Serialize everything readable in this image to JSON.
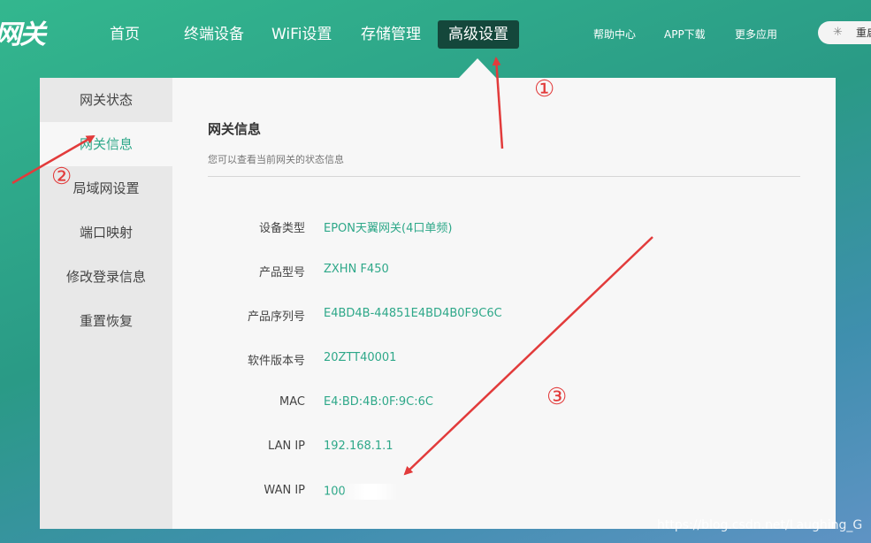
{
  "logo": {
    "text": "网关"
  },
  "nav": {
    "items": [
      {
        "label": "首页"
      },
      {
        "label": "终端设备"
      },
      {
        "label": "WiFi设置"
      },
      {
        "label": "存储管理"
      },
      {
        "label": "高级设置",
        "active": true
      }
    ]
  },
  "utility": {
    "help": "帮助中心",
    "app": "APP下载",
    "more": "更多应用",
    "restart": "重启"
  },
  "sidebar": {
    "items": [
      {
        "label": "网关状态"
      },
      {
        "label": "网关信息",
        "active": true
      },
      {
        "label": "局域网设置"
      },
      {
        "label": "端口映射"
      },
      {
        "label": "修改登录信息"
      },
      {
        "label": "重置恢复"
      }
    ]
  },
  "content": {
    "title": "网关信息",
    "subtitle": "您可以查看当前网关的状态信息",
    "rows": [
      {
        "label": "设备类型",
        "value": "EPON天翼网关(4口单频)"
      },
      {
        "label": "产品型号",
        "value": "ZXHN F450"
      },
      {
        "label": "产品序列号",
        "value": "E4BD4B-44851E4BD4B0F9C6C"
      },
      {
        "label": "软件版本号",
        "value": "20ZTT40001"
      },
      {
        "label": "MAC",
        "value": "E4:BD:4B:0F:9C:6C"
      },
      {
        "label": "LAN IP",
        "value": "192.168.1.1"
      },
      {
        "label": "WAN IP",
        "value": "100"
      }
    ]
  },
  "annotations": {
    "one": "①",
    "two": "②",
    "three": "③"
  },
  "watermark": "https://blog.csdn.net/Laughing_G",
  "colors": {
    "accent": "#2ea889",
    "nav_active": "#14473b",
    "arrow": "#e23b3b"
  }
}
